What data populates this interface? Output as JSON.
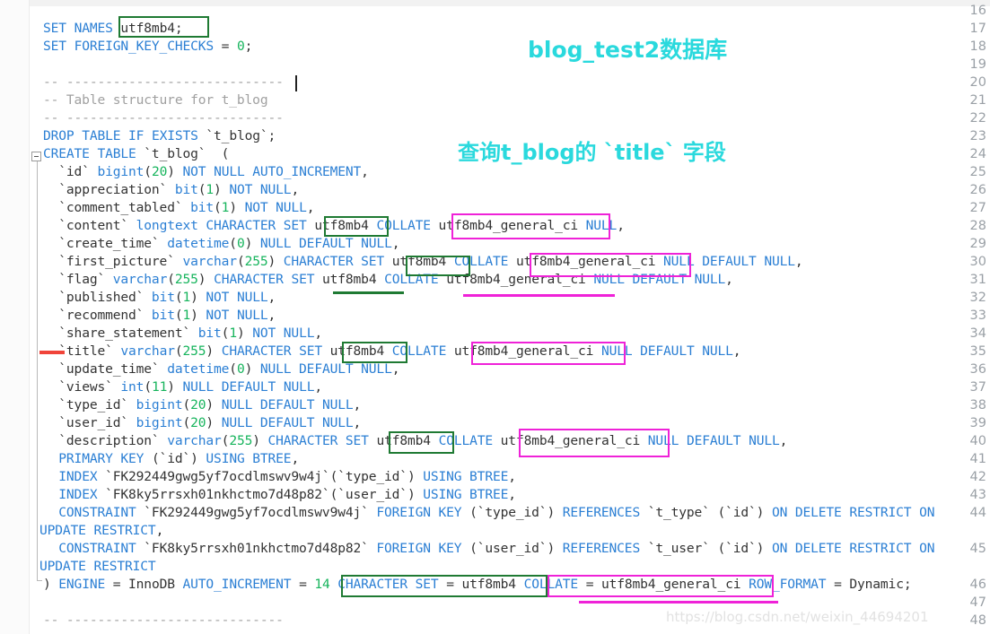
{
  "editor": {
    "language": "sql",
    "colors": {
      "background": "#ffffff",
      "gutter_background": "#fbfbfb",
      "line_number": "#9aa0a6",
      "keyword": "#2b7fd4",
      "number": "#16b45c",
      "comment": "#a0a0a0",
      "identifier": "#333333",
      "annotation_green": "#1f7a33",
      "annotation_pink": "#ef22d8",
      "annotation_red": "#f0443a",
      "note_cyan": "#2ad9dd",
      "watermark": "#e2e2e2"
    }
  },
  "gutter": {
    "line_numbers": [
      "16",
      "17",
      "18",
      "19",
      "20",
      "21",
      "22",
      "23",
      "24",
      "25",
      "26",
      "27",
      "28",
      "29",
      "30",
      "31",
      "32",
      "33",
      "34",
      "35",
      "36",
      "37",
      "38",
      "39",
      "40",
      "41",
      "42",
      "43",
      "44",
      "45",
      "46",
      "47",
      "48"
    ]
  },
  "lines": [
    {
      "n": "16",
      "text": ""
    },
    {
      "n": "17",
      "text": "SET NAMES utf8mb4;"
    },
    {
      "n": "18",
      "text": "SET FOREIGN_KEY_CHECKS = 0;"
    },
    {
      "n": "19",
      "text": ""
    },
    {
      "n": "20",
      "text": "-- ----------------------------"
    },
    {
      "n": "21",
      "text": "-- Table structure for t_blog"
    },
    {
      "n": "22",
      "text": "-- ----------------------------"
    },
    {
      "n": "23",
      "text": "DROP TABLE IF EXISTS `t_blog`;"
    },
    {
      "n": "24",
      "text": "CREATE TABLE `t_blog`  ("
    },
    {
      "n": "25",
      "text": "  `id` bigint(20) NOT NULL AUTO_INCREMENT,"
    },
    {
      "n": "26",
      "text": "  `appreciation` bit(1) NOT NULL,"
    },
    {
      "n": "27",
      "text": "  `comment_tabled` bit(1) NOT NULL,"
    },
    {
      "n": "28",
      "text": "  `content` longtext CHARACTER SET utf8mb4 COLLATE utf8mb4_general_ci NULL,"
    },
    {
      "n": "29",
      "text": "  `create_time` datetime(0) NULL DEFAULT NULL,"
    },
    {
      "n": "30",
      "text": "  `first_picture` varchar(255) CHARACTER SET utf8mb4 COLLATE utf8mb4_general_ci NULL DEFAULT NULL,"
    },
    {
      "n": "31",
      "text": "  `flag` varchar(255) CHARACTER SET utf8mb4 COLLATE utf8mb4_general_ci NULL DEFAULT NULL,"
    },
    {
      "n": "32",
      "text": "  `published` bit(1) NOT NULL,"
    },
    {
      "n": "33",
      "text": "  `recommend` bit(1) NOT NULL,"
    },
    {
      "n": "34",
      "text": "  `share_statement` bit(1) NOT NULL,"
    },
    {
      "n": "35",
      "text": "  `title` varchar(255) CHARACTER SET utf8mb4 COLLATE utf8mb4_general_ci NULL DEFAULT NULL,"
    },
    {
      "n": "36",
      "text": "  `update_time` datetime(0) NULL DEFAULT NULL,"
    },
    {
      "n": "37",
      "text": "  `views` int(11) NULL DEFAULT NULL,"
    },
    {
      "n": "38",
      "text": "  `type_id` bigint(20) NULL DEFAULT NULL,"
    },
    {
      "n": "39",
      "text": "  `user_id` bigint(20) NULL DEFAULT NULL,"
    },
    {
      "n": "40",
      "text": "  `description` varchar(255) CHARACTER SET utf8mb4 COLLATE utf8mb4_general_ci NULL DEFAULT NULL,"
    },
    {
      "n": "41",
      "text": "  PRIMARY KEY (`id`) USING BTREE,"
    },
    {
      "n": "42",
      "text": "  INDEX `FK292449gwg5yf7ocdlmswv9w4j`(`type_id`) USING BTREE,"
    },
    {
      "n": "43",
      "text": "  INDEX `FK8ky5rrsxh01nkhctmo7d48p82`(`user_id`) USING BTREE,"
    },
    {
      "n": "44",
      "text": "  CONSTRAINT `FK292449gwg5yf7ocdlmswv9w4j` FOREIGN KEY (`type_id`) REFERENCES `t_type` (`id`) ON DELETE RESTRICT ON UPDATE RESTRICT,"
    },
    {
      "n": "45",
      "text": "  CONSTRAINT `FK8ky5rrsxh01nkhctmo7d48p82` FOREIGN KEY (`user_id`) REFERENCES `t_user` (`id`) ON DELETE RESTRICT ON UPDATE RESTRICT"
    },
    {
      "n": "46",
      "text": ") ENGINE = InnoDB AUTO_INCREMENT = 14 CHARACTER SET = utf8mb4 COLLATE = utf8mb4_general_ci ROW_FORMAT = Dynamic;"
    },
    {
      "n": "47",
      "text": ""
    },
    {
      "n": "48",
      "text": "-- ----------------------------"
    }
  ],
  "notes": [
    {
      "id": "db-name-note",
      "text": "blog_test2数据库"
    },
    {
      "id": "title-field-note",
      "text": "查询t_blog的 `title` 字段"
    }
  ],
  "annotations": {
    "green_label": "utf8mb4",
    "pink_label": "utf8mb4_general_ci",
    "green_charset_label": "CHARACTER SET = utf8mb4",
    "pink_collate_label": "COLLATE = utf8mb4_general_ci",
    "row_marker_line": "35"
  },
  "watermark": {
    "text": "https://blog.csdn.net/weixin_44694201"
  }
}
